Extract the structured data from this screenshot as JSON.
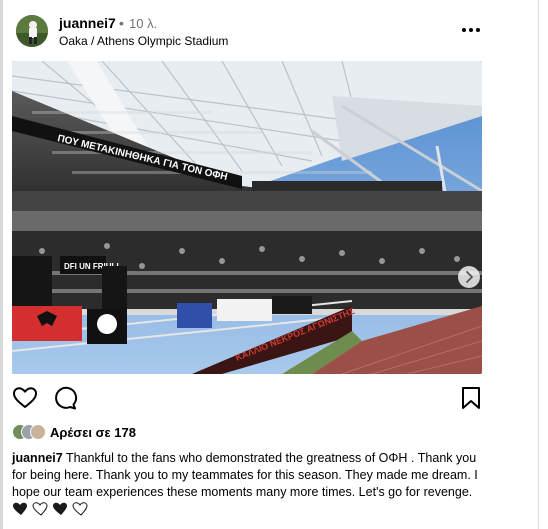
{
  "post": {
    "username": "juannei7",
    "separator": "•",
    "time_ago": "10 λ.",
    "location": "Oaka / Athens Olympic Stadium",
    "more_icon": "more-horizontal-icon"
  },
  "photo": {
    "banner_texts": [
      "ΠΟΥ ΜΕΤΑΚΙΝΗΘΗΚΑ ΓΙΑ ΤΟΝ ΟΦΗ",
      "DFI UN FRIULI",
      "ΚΑΛΛΙΟ ΝΕΚΡΟΣ ΑΓΩΝΙΣΤΗΣ"
    ],
    "carousel_count": 5,
    "carousel_active": 0,
    "next_icon": "chevron-right-icon"
  },
  "actions": {
    "like_icon": "heart-outline-icon",
    "comment_icon": "comment-bubble-icon",
    "save_icon": "bookmark-icon"
  },
  "likes": {
    "text": "Αρέσει σε 178"
  },
  "caption": {
    "username": "juannei7",
    "text": "Thankful to the fans who demonstrated the greatness of ΟΦΗ . Thank you for being here. Thank you to my teammates for this season. They made me dream. I hope our team experiences these moments many more times. Let's go for revenge.",
    "hearts": [
      "black",
      "white",
      "black",
      "white"
    ]
  },
  "colors": {
    "sky": "#6fa1d8",
    "crowd": "#2b2b2b",
    "track": "#a0524a",
    "muted_text": "#737373"
  }
}
